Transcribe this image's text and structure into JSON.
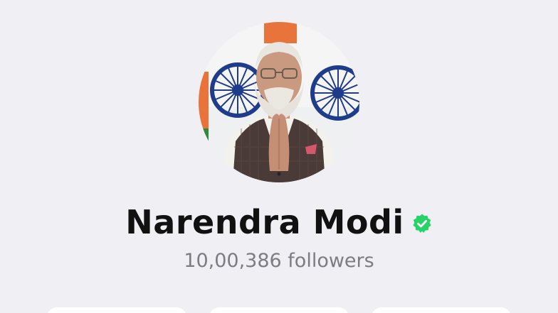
{
  "profile": {
    "name": "Narendra Modi",
    "followers_text": "10,00,386 followers",
    "verified": true
  },
  "colors": {
    "background": "#f0eff4",
    "name": "#111111",
    "followers": "#7c7c82",
    "verified_badge": "#25d366"
  },
  "icons": {
    "verified": "verified-badge-icon"
  }
}
